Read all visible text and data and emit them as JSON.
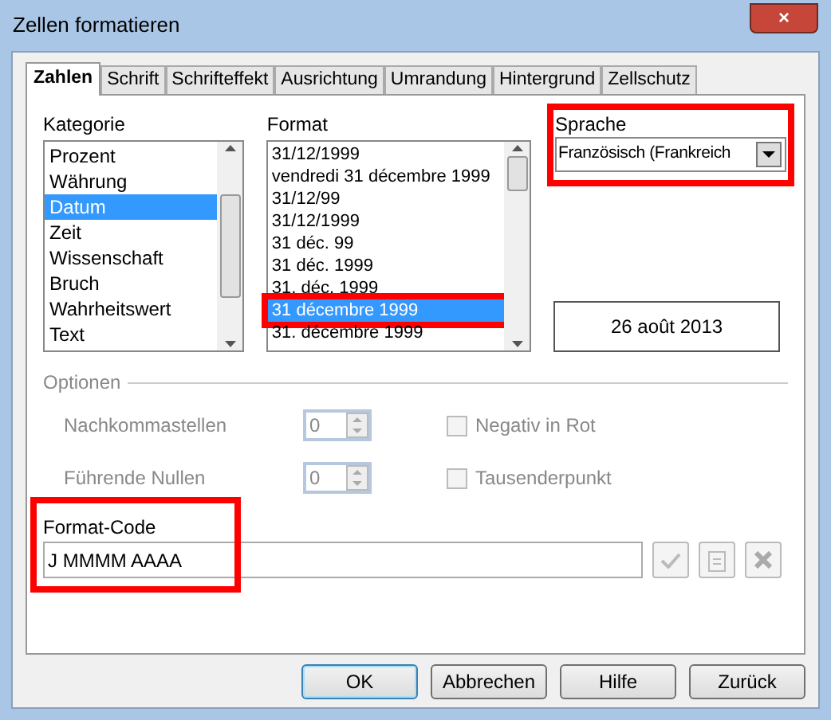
{
  "window": {
    "title": "Zellen formatieren",
    "close": "×"
  },
  "tabs": [
    {
      "label": "Zahlen",
      "selected": true
    },
    {
      "label": "Schrift",
      "selected": false
    },
    {
      "label": "Schrifteffekt",
      "selected": false
    },
    {
      "label": "Ausrichtung",
      "selected": false
    },
    {
      "label": "Umrandung",
      "selected": false
    },
    {
      "label": "Hintergrund",
      "selected": false
    },
    {
      "label": "Zellschutz",
      "selected": false
    }
  ],
  "kategorie": {
    "label": "Kategorie",
    "items": [
      {
        "label": "Prozent",
        "selected": false
      },
      {
        "label": "Währung",
        "selected": false
      },
      {
        "label": "Datum",
        "selected": true
      },
      {
        "label": "Zeit",
        "selected": false
      },
      {
        "label": "Wissenschaft",
        "selected": false
      },
      {
        "label": "Bruch",
        "selected": false
      },
      {
        "label": "Wahrheitswert",
        "selected": false
      },
      {
        "label": "Text",
        "selected": false
      }
    ]
  },
  "format": {
    "label": "Format",
    "items": [
      {
        "label": "31/12/1999",
        "selected": false,
        "highlighted": false
      },
      {
        "label": "vendredi 31 décembre 1999",
        "selected": false,
        "highlighted": false
      },
      {
        "label": "31/12/99",
        "selected": false,
        "highlighted": false
      },
      {
        "label": "31/12/1999",
        "selected": false,
        "highlighted": false
      },
      {
        "label": "31 déc. 99",
        "selected": false,
        "highlighted": false
      },
      {
        "label": "31 déc. 1999",
        "selected": false,
        "highlighted": false
      },
      {
        "label": "31. déc. 1999",
        "selected": false,
        "highlighted": false
      },
      {
        "label": "31 décembre 1999",
        "selected": true,
        "highlighted": true
      },
      {
        "label": "31. décembre 1999",
        "selected": false,
        "highlighted": false
      }
    ]
  },
  "sprache": {
    "label": "Sprache",
    "value": "Französisch (Frankreich",
    "highlighted": true
  },
  "preview": "26 août 2013",
  "optionen": {
    "label": "Optionen",
    "disabled": true,
    "spinners": [
      {
        "label": "Nachkommastellen",
        "value": "0"
      },
      {
        "label": "Führende Nullen",
        "value": "0"
      }
    ],
    "checkboxes": [
      {
        "label": "Negativ in Rot",
        "checked": false
      },
      {
        "label": "Tausenderpunkt",
        "checked": false
      }
    ]
  },
  "format_code": {
    "label": "Format-Code",
    "value": "J MMMM AAAA",
    "highlighted": true
  },
  "buttons": [
    {
      "label": "OK",
      "default": true
    },
    {
      "label": "Abbrechen",
      "default": false
    },
    {
      "label": "Hilfe",
      "default": false
    },
    {
      "label": "Zurück",
      "default": false
    }
  ]
}
